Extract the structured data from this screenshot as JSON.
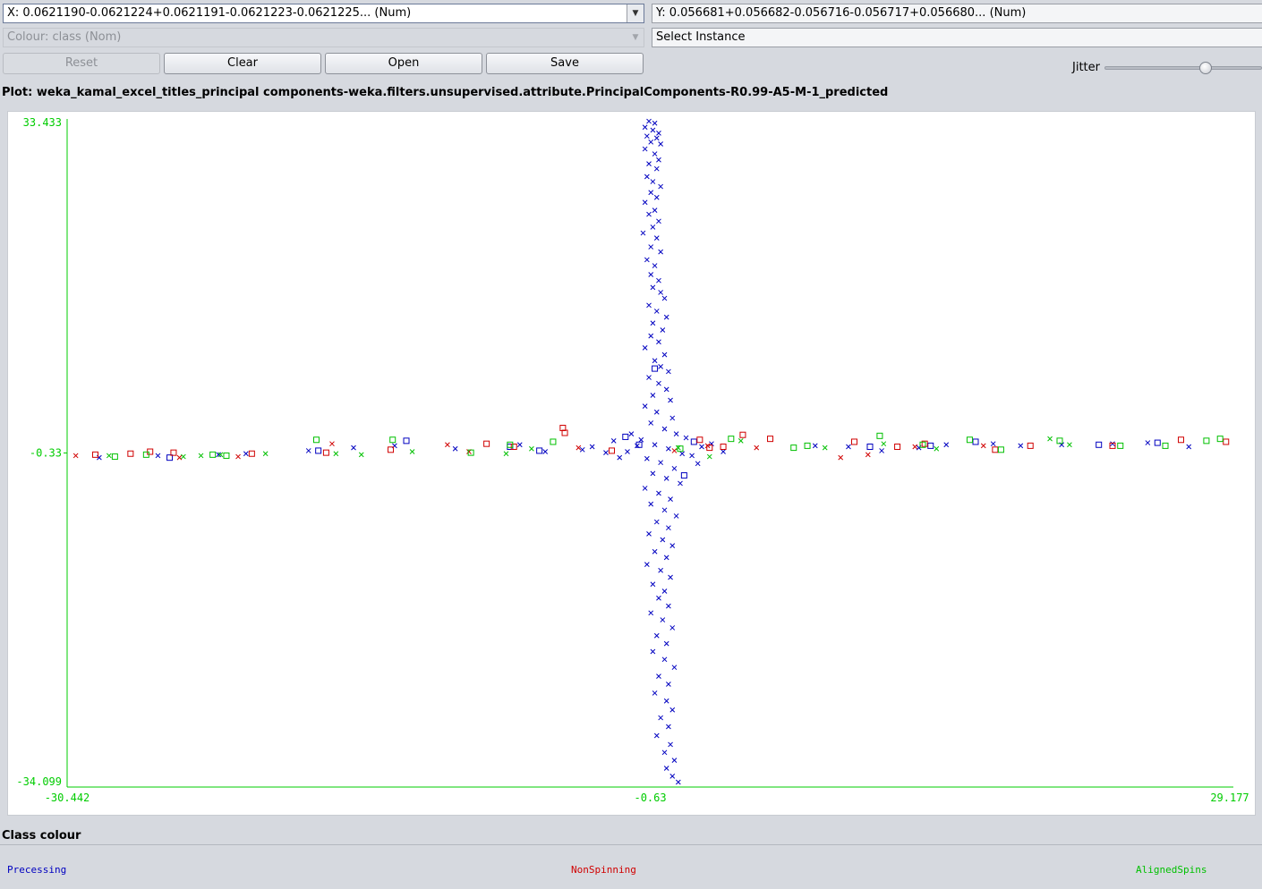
{
  "controls": {
    "x_axis": "X: 0.0621190-0.0621224+0.0621191-0.0621223-0.0621225... (Num)",
    "y_axis": "Y: 0.056681+0.056682-0.056716-0.056717+0.056680... (Num)",
    "colour": "Colour: class (Nom)",
    "select_instance": "Select Instance",
    "reset_label": "Reset",
    "clear_label": "Clear",
    "open_label": "Open",
    "save_label": "Save",
    "jitter_label": "Jitter",
    "jitter_level": 0.64
  },
  "plot_title": "Plot: weka_kamal_excel_titles_principal components-weka.filters.unsupervised.attribute.PrincipalComponents-R0.99-A5-M-1_predicted",
  "legend": {
    "title": "Class colour",
    "items": [
      {
        "label": "Precessing",
        "color": "#0000c0"
      },
      {
        "label": "NonSpinning",
        "color": "#d00000"
      },
      {
        "label": "AlignedSpins",
        "color": "#00c000"
      }
    ]
  },
  "chart_data": {
    "type": "scatter",
    "title": "",
    "axis_color": "#00cc00",
    "xlim": [
      -30.442,
      29.177
    ],
    "ylim": [
      -34.099,
      33.433
    ],
    "x_ticks": [
      "-30.442",
      "-0.63",
      "29.177"
    ],
    "y_ticks": [
      "33.433",
      "-0.33",
      "-34.099"
    ],
    "markers": {
      "cross": "correctly classified",
      "square": "misclassified"
    },
    "series": [
      {
        "name": "Precessing",
        "color": "#0000c0",
        "crosses": [
          [
            -0.7,
            33.2
          ],
          [
            -0.4,
            33.0
          ],
          [
            -0.9,
            32.6
          ],
          [
            -0.5,
            32.3
          ],
          [
            -0.2,
            32.0
          ],
          [
            -0.8,
            31.7
          ],
          [
            -0.3,
            31.5
          ],
          [
            -0.6,
            31.1
          ],
          [
            -0.1,
            30.9
          ],
          [
            -0.9,
            30.4
          ],
          [
            -0.4,
            29.9
          ],
          [
            -0.2,
            29.3
          ],
          [
            -0.7,
            28.9
          ],
          [
            -0.3,
            28.4
          ],
          [
            -0.8,
            27.6
          ],
          [
            -0.5,
            27.1
          ],
          [
            -0.1,
            26.6
          ],
          [
            -0.6,
            26.0
          ],
          [
            -0.3,
            25.5
          ],
          [
            -0.9,
            25.0
          ],
          [
            -0.4,
            24.2
          ],
          [
            -0.7,
            23.8
          ],
          [
            -0.2,
            23.1
          ],
          [
            -0.5,
            22.5
          ],
          [
            -1.0,
            21.9
          ],
          [
            -0.3,
            21.4
          ],
          [
            -0.6,
            20.5
          ],
          [
            -0.1,
            20.0
          ],
          [
            -0.8,
            19.2
          ],
          [
            -0.4,
            18.6
          ],
          [
            -0.6,
            17.7
          ],
          [
            -0.2,
            17.1
          ],
          [
            -0.5,
            16.4
          ],
          [
            -0.1,
            15.9
          ],
          [
            0.1,
            15.3
          ],
          [
            -0.7,
            14.6
          ],
          [
            -0.3,
            14.0
          ],
          [
            0.2,
            13.4
          ],
          [
            -0.5,
            12.8
          ],
          [
            0.0,
            12.1
          ],
          [
            -0.6,
            11.5
          ],
          [
            -0.2,
            10.9
          ],
          [
            -0.9,
            10.3
          ],
          [
            0.1,
            9.6
          ],
          [
            -0.4,
            9.0
          ],
          [
            -0.1,
            8.4
          ],
          [
            0.3,
            7.9
          ],
          [
            -0.7,
            7.3
          ],
          [
            -0.2,
            6.7
          ],
          [
            0.2,
            6.1
          ],
          [
            -0.5,
            5.5
          ],
          [
            0.4,
            5.0
          ],
          [
            -0.9,
            4.4
          ],
          [
            -0.3,
            3.8
          ],
          [
            0.5,
            3.2
          ],
          [
            -0.6,
            2.7
          ],
          [
            0.1,
            2.1
          ],
          [
            0.7,
            1.6
          ],
          [
            -1.1,
            1.0
          ],
          [
            -0.4,
            0.5
          ],
          [
            0.3,
            0.1
          ],
          [
            1.0,
            -0.4
          ],
          [
            -0.8,
            -0.9
          ],
          [
            -0.1,
            -1.3
          ],
          [
            0.6,
            -1.9
          ],
          [
            -0.5,
            -2.4
          ],
          [
            0.2,
            -2.9
          ],
          [
            0.9,
            -3.4
          ],
          [
            -0.9,
            -3.9
          ],
          [
            -0.2,
            -4.4
          ],
          [
            0.4,
            -5.0
          ],
          [
            -0.6,
            -5.5
          ],
          [
            0.1,
            -6.1
          ],
          [
            0.7,
            -6.7
          ],
          [
            -0.3,
            -7.3
          ],
          [
            0.3,
            -7.9
          ],
          [
            -0.7,
            -8.5
          ],
          [
            0.0,
            -9.1
          ],
          [
            0.5,
            -9.7
          ],
          [
            -0.4,
            -10.3
          ],
          [
            0.2,
            -10.9
          ],
          [
            -0.8,
            -11.6
          ],
          [
            -0.1,
            -12.2
          ],
          [
            0.4,
            -12.9
          ],
          [
            -0.5,
            -13.6
          ],
          [
            0.1,
            -14.3
          ],
          [
            -0.2,
            -15.0
          ],
          [
            0.3,
            -15.8
          ],
          [
            -0.6,
            -16.5
          ],
          [
            0.0,
            -17.2
          ],
          [
            0.5,
            -18.0
          ],
          [
            -0.3,
            -18.8
          ],
          [
            0.2,
            -19.6
          ],
          [
            -0.5,
            -20.4
          ],
          [
            0.1,
            -21.2
          ],
          [
            0.6,
            -22.0
          ],
          [
            -0.2,
            -22.9
          ],
          [
            0.3,
            -23.7
          ],
          [
            -0.4,
            -24.6
          ],
          [
            0.2,
            -25.4
          ],
          [
            0.5,
            -26.3
          ],
          [
            -0.1,
            -27.1
          ],
          [
            0.3,
            -28.0
          ],
          [
            -0.3,
            -28.9
          ],
          [
            0.4,
            -29.8
          ],
          [
            0.1,
            -30.6
          ],
          [
            0.6,
            -31.4
          ],
          [
            0.2,
            -32.2
          ],
          [
            0.5,
            -33.0
          ],
          [
            0.8,
            -33.6
          ],
          [
            -2.5,
            0.9
          ],
          [
            -1.8,
            -0.2
          ],
          [
            -1.3,
            0.4
          ],
          [
            -2.2,
            -0.8
          ],
          [
            -1.6,
            1.6
          ],
          [
            1.5,
            -0.6
          ],
          [
            2.0,
            0.3
          ],
          [
            1.2,
            1.2
          ],
          [
            1.8,
            -1.4
          ],
          [
            2.5,
            0.6
          ],
          [
            -2.9,
            -0.3
          ],
          [
            3.1,
            -0.2
          ],
          [
            -28.8,
            -0.8
          ],
          [
            -25.8,
            -0.6
          ],
          [
            -22.7,
            -0.5
          ],
          [
            -21.3,
            -0.4
          ],
          [
            -18.1,
            -0.1
          ],
          [
            -15.8,
            0.2
          ],
          [
            -13.7,
            0.4
          ],
          [
            -10.6,
            0.1
          ],
          [
            -7.3,
            0.5
          ],
          [
            -6.0,
            -0.2
          ],
          [
            -4.1,
            0.0
          ],
          [
            -3.6,
            0.3
          ],
          [
            7.8,
            0.4
          ],
          [
            9.5,
            0.3
          ],
          [
            11.2,
            -0.1
          ],
          [
            13.1,
            0.2
          ],
          [
            14.5,
            0.5
          ],
          [
            16.9,
            0.6
          ],
          [
            18.3,
            0.4
          ],
          [
            20.4,
            0.5
          ],
          [
            23.0,
            0.6
          ],
          [
            24.8,
            0.7
          ],
          [
            26.9,
            0.3
          ]
        ],
        "squares": [
          [
            -1.2,
            0.5
          ],
          [
            1.1,
            -2.6
          ],
          [
            -1.9,
            1.3
          ],
          [
            -6.3,
            -0.1
          ],
          [
            -0.4,
            8.2
          ],
          [
            -25.2,
            -0.8
          ],
          [
            -17.6,
            -0.1
          ],
          [
            -13.1,
            0.9
          ],
          [
            -7.8,
            0.3
          ],
          [
            10.6,
            0.3
          ],
          [
            13.7,
            0.4
          ],
          [
            16.0,
            0.8
          ],
          [
            22.3,
            0.5
          ],
          [
            25.3,
            0.7
          ],
          [
            1.6,
            0.8
          ]
        ]
      },
      {
        "name": "NonSpinning",
        "color": "#d00000",
        "crosses": [
          [
            -30.0,
            -0.6
          ],
          [
            -24.7,
            -0.8
          ],
          [
            -9.9,
            -0.2
          ],
          [
            -4.3,
            0.2
          ],
          [
            0.6,
            -0.1
          ],
          [
            2.3,
            0.4
          ],
          [
            4.8,
            0.2
          ],
          [
            9.1,
            -0.8
          ],
          [
            10.5,
            -0.5
          ],
          [
            12.9,
            0.3
          ],
          [
            16.4,
            0.4
          ],
          [
            -16.9,
            0.6
          ],
          [
            -21.7,
            -0.7
          ],
          [
            -11.0,
            0.5
          ]
        ],
        "squares": [
          [
            -29.0,
            -0.5
          ],
          [
            -27.2,
            -0.4
          ],
          [
            -26.2,
            -0.2
          ],
          [
            -25.0,
            -0.3
          ],
          [
            -21.0,
            -0.4
          ],
          [
            -17.2,
            -0.3
          ],
          [
            -13.9,
            0.0
          ],
          [
            -9.0,
            0.6
          ],
          [
            -7.6,
            0.3
          ],
          [
            -5.1,
            2.2
          ],
          [
            -5.0,
            1.7
          ],
          [
            -2.6,
            -0.1
          ],
          [
            1.9,
            1.0
          ],
          [
            2.4,
            0.2
          ],
          [
            3.1,
            0.3
          ],
          [
            4.1,
            1.5
          ],
          [
            5.5,
            1.1
          ],
          [
            9.8,
            0.8
          ],
          [
            12.0,
            0.3
          ],
          [
            13.4,
            0.6
          ],
          [
            17.0,
            0.0
          ],
          [
            18.8,
            0.4
          ],
          [
            23.0,
            0.4
          ],
          [
            26.5,
            1.0
          ],
          [
            28.8,
            0.8
          ]
        ]
      },
      {
        "name": "AlignedSpins",
        "color": "#00c000",
        "crosses": [
          [
            -28.3,
            -0.6
          ],
          [
            -24.5,
            -0.7
          ],
          [
            -22.6,
            -0.5
          ],
          [
            -20.3,
            -0.4
          ],
          [
            -15.4,
            -0.5
          ],
          [
            -12.8,
            -0.2
          ],
          [
            -8.0,
            -0.4
          ],
          [
            -6.7,
            0.1
          ],
          [
            0.8,
            0.2
          ],
          [
            2.4,
            -0.7
          ],
          [
            4.0,
            0.9
          ],
          [
            8.3,
            0.2
          ],
          [
            11.3,
            0.6
          ],
          [
            14.0,
            0.1
          ],
          [
            19.8,
            1.1
          ],
          [
            20.8,
            0.5
          ],
          [
            -23.6,
            -0.6
          ],
          [
            -16.7,
            -0.4
          ]
        ],
        "squares": [
          [
            -28.0,
            -0.7
          ],
          [
            -26.4,
            -0.5
          ],
          [
            -22.3,
            -0.6
          ],
          [
            -23.0,
            -0.5
          ],
          [
            -17.7,
            1.0
          ],
          [
            -9.8,
            -0.3
          ],
          [
            -7.8,
            0.5
          ],
          [
            -5.6,
            0.8
          ],
          [
            0.9,
            0.1
          ],
          [
            3.5,
            1.1
          ],
          [
            6.7,
            0.2
          ],
          [
            7.4,
            0.4
          ],
          [
            11.1,
            1.4
          ],
          [
            13.3,
            0.5
          ],
          [
            15.7,
            1.0
          ],
          [
            17.3,
            0.0
          ],
          [
            20.3,
            0.9
          ],
          [
            23.4,
            0.4
          ],
          [
            25.7,
            0.4
          ],
          [
            27.8,
            0.9
          ],
          [
            28.5,
            1.1
          ],
          [
            -13.8,
            1.0
          ]
        ]
      }
    ]
  }
}
